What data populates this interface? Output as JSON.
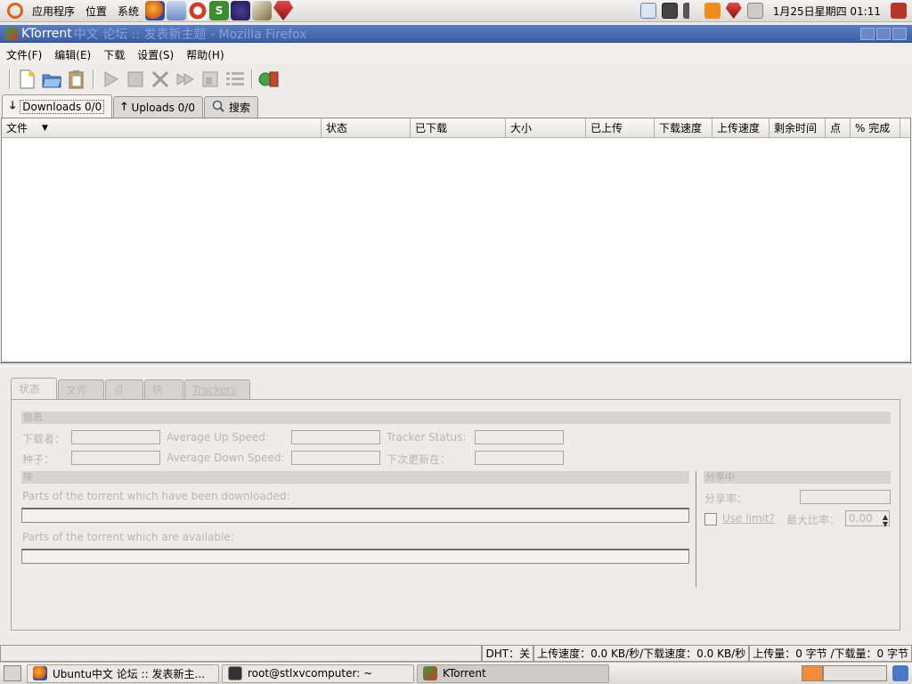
{
  "top_panel": {
    "menus": [
      "应用程序",
      "位置",
      "系统"
    ],
    "launchers": [
      "firefox-icon",
      "mail-icon",
      "help-icon",
      "terminal-icon",
      "eclipse-icon",
      "bird-icon",
      "ruby-icon"
    ],
    "clock": "1月25日星期四 01:11",
    "tray": [
      "network-icon",
      "display-icon",
      "volume-icon",
      "update-icon",
      "ruby-icon",
      "printer-icon",
      "logout-icon"
    ]
  },
  "window": {
    "title": "KTorrent",
    "ghost_title": "中文 论坛 :: 发表新主题 - Mozilla Firefox"
  },
  "menubar": [
    "文件(F)",
    "编辑(E)",
    "下载",
    "设置(S)",
    "帮助(H)"
  ],
  "tabs": [
    {
      "label": "Downloads 0/0",
      "icon": "arrow-down-icon"
    },
    {
      "label": "Uploads 0/0",
      "icon": "arrow-up-icon"
    },
    {
      "label": "搜索",
      "icon": "search-icon"
    }
  ],
  "columns": [
    "文件",
    "状态",
    "已下载",
    "大小",
    "已上传",
    "下载速度",
    "上传速度",
    "剩余时间",
    "点",
    "% 完成"
  ],
  "detail": {
    "tabs": [
      "状态",
      "文件",
      "点",
      "块",
      "Trackers"
    ],
    "info_header": "信息",
    "downloaded_label": "下载者：",
    "seeders_label": "种子：",
    "avg_up_label": "Average Up Speed:",
    "avg_down_label": "Average Down Speed:",
    "tracker_status_label": "Tracker Status:",
    "next_update_label": "下次更新在：",
    "chunks_header": "块",
    "downloaded_parts_label": "Parts of the torrent which have been downloaded:",
    "available_parts_label": "Parts of the torrent which are available:",
    "share_header": "分享中",
    "share_ratio_label": "分享率：",
    "use_limit_label": "Use limit?",
    "max_ratio_label": "最大比率：",
    "max_ratio_value": "0.00"
  },
  "statusbar": {
    "empty": "",
    "dht": "DHT：关",
    "speed": "上传速度：0.0 KB/秒/下载速度：0.0 KB/秒",
    "transfer": "上传量：0 字节 /下载量：0 字节"
  },
  "taskbar": [
    {
      "label": "Ubuntu中文 论坛 :: 发表新主...",
      "icon": "firefox-icon"
    },
    {
      "label": "root@stlxvcomputer: ~",
      "icon": "terminal-icon"
    },
    {
      "label": "KTorrent",
      "icon": "ktorrent-icon"
    }
  ],
  "colors": {
    "title_active": "#4a6cb3",
    "panel_bg": "#e6e3de",
    "accent_orange": "#d9661c"
  }
}
